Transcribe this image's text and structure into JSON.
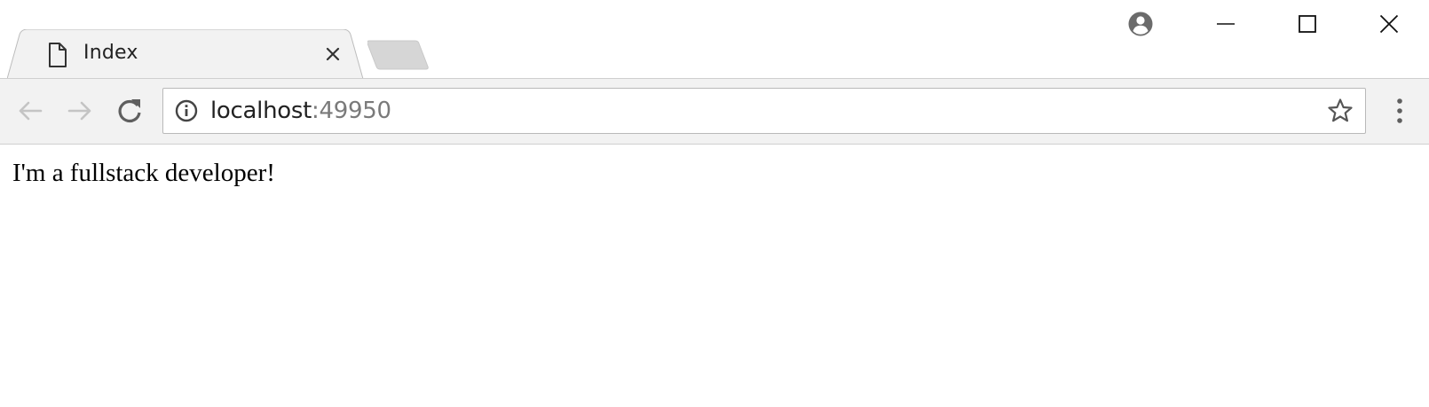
{
  "tab": {
    "title": "Index",
    "icon": "document-icon"
  },
  "window_controls": {
    "profile_icon": "account-circle-icon",
    "minimize_icon": "minimize-icon",
    "maximize_icon": "maximize-icon",
    "close_icon": "close-icon"
  },
  "toolbar": {
    "back_icon": "arrow-left-icon",
    "forward_icon": "arrow-right-icon",
    "reload_icon": "reload-icon",
    "menu_icon": "vertical-dots-icon"
  },
  "address_bar": {
    "host": "localhost",
    "port": ":49950",
    "info_icon": "info-icon",
    "bookmark_icon": "star-icon"
  },
  "page": {
    "text": "I'm a fullstack developer!"
  },
  "colors": {
    "tab_background": "#f2f2f2",
    "tab_border": "#bcbcbc",
    "new_tab_fill": "#d6d6d6",
    "toolbar_background": "#f2f2f2",
    "icon_gray": "#5f5f5f",
    "disabled_gray": "#c4c4c4",
    "port_gray": "#7a7a7a"
  }
}
